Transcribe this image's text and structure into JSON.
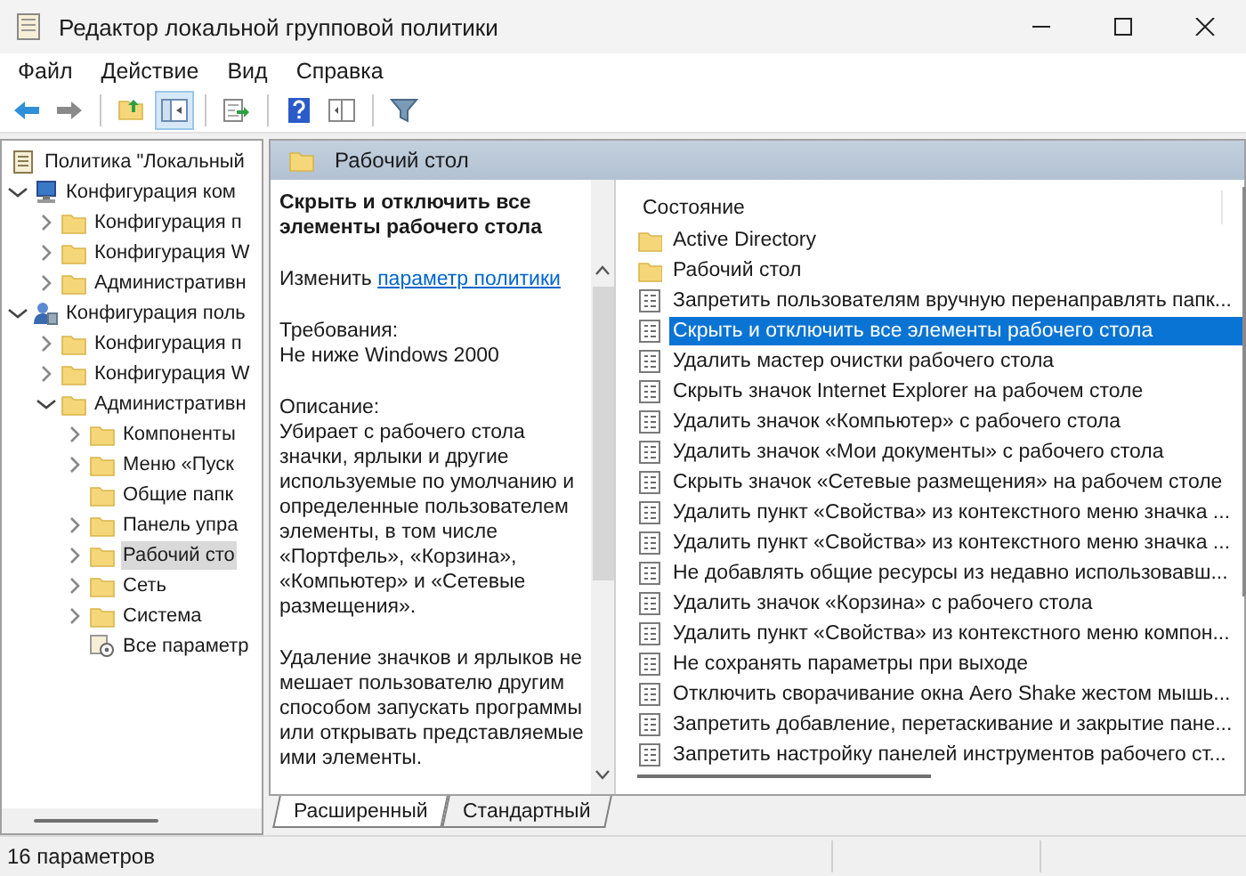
{
  "window": {
    "title": "Редактор локальной групповой политики"
  },
  "menu": [
    "Файл",
    "Действие",
    "Вид",
    "Справка"
  ],
  "toolbar": [
    {
      "kind": "back",
      "pressed": false
    },
    {
      "kind": "forward",
      "pressed": false
    },
    {
      "kind": "sep"
    },
    {
      "kind": "folder-up",
      "pressed": false
    },
    {
      "kind": "tree-toggle",
      "pressed": true
    },
    {
      "kind": "sep"
    },
    {
      "kind": "export",
      "pressed": false
    },
    {
      "kind": "sep"
    },
    {
      "kind": "help",
      "pressed": false
    },
    {
      "kind": "view",
      "pressed": false
    },
    {
      "kind": "sep"
    },
    {
      "kind": "filter",
      "pressed": false
    }
  ],
  "tree": [
    {
      "label": "Политика \"Локальный",
      "kind": "policy-doc",
      "selected": false,
      "children": [
        {
          "label": "Конфигурация ком",
          "kind": "computer",
          "expanded": true,
          "selected": false,
          "children": [
            {
              "label": "Конфигурация п",
              "kind": "folder",
              "expanded": false,
              "selected": false
            },
            {
              "label": "Конфигурация W",
              "kind": "folder",
              "expanded": false,
              "selected": false
            },
            {
              "label": "Административн",
              "kind": "folder",
              "expanded": false,
              "selected": false
            }
          ]
        },
        {
          "label": "Конфигурация поль",
          "kind": "user",
          "expanded": true,
          "selected": false,
          "children": [
            {
              "label": "Конфигурация п",
              "kind": "folder",
              "expanded": false,
              "selected": false
            },
            {
              "label": "Конфигурация W",
              "kind": "folder",
              "expanded": false,
              "selected": false
            },
            {
              "label": "Административн",
              "kind": "folder",
              "expanded": true,
              "selected": false,
              "children": [
                {
                  "label": "Компоненты",
                  "kind": "folder",
                  "expanded": false,
                  "selected": false
                },
                {
                  "label": "Меню «Пуск",
                  "kind": "folder",
                  "expanded": false,
                  "selected": false
                },
                {
                  "label": "Общие папк",
                  "kind": "folder",
                  "selected": false
                },
                {
                  "label": "Панель упра",
                  "kind": "folder",
                  "expanded": false,
                  "selected": false
                },
                {
                  "label": "Рабочий сто",
                  "kind": "folder",
                  "expanded": false,
                  "selected": true
                },
                {
                  "label": "Сеть",
                  "kind": "folder",
                  "expanded": false,
                  "selected": false
                },
                {
                  "label": "Система",
                  "kind": "folder",
                  "expanded": false,
                  "selected": false
                },
                {
                  "label": "Все параметр",
                  "kind": "settings",
                  "selected": false
                }
              ]
            }
          ]
        }
      ]
    }
  ],
  "header": {
    "title": "Рабочий стол"
  },
  "description": {
    "title": "Скрыть и отключить все элементы рабочего стола",
    "edit_prefix": "Изменить",
    "edit_link": "параметр политики",
    "requirements_label": "Требования:",
    "requirements": "Не ниже Windows 2000",
    "description_label": "Описание:",
    "description": "Убирает с рабочего стола значки, ярлыки и другие используемые по умолчанию и определенные пользователем элементы, в том числе «Портфель», «Корзина», «Компьютер» и «Сетевые размещения».",
    "note": "Удаление значков и ярлыков не мешает пользователю другим способом запускать программы или открывать представляемые ими элементы."
  },
  "list": {
    "column": "Состояние",
    "items": [
      {
        "label": "Active Directory",
        "kind": "folder",
        "selected": false
      },
      {
        "label": "Рабочий стол",
        "kind": "folder",
        "selected": false
      },
      {
        "label": "Запретить пользователям вручную перенаправлять папк...",
        "kind": "policy",
        "selected": false
      },
      {
        "label": "Скрыть и отключить все элементы рабочего стола",
        "kind": "policy",
        "selected": true
      },
      {
        "label": "Удалить мастер очистки рабочего стола",
        "kind": "policy",
        "selected": false
      },
      {
        "label": "Скрыть значок Internet Explorer на рабочем столе",
        "kind": "policy",
        "selected": false
      },
      {
        "label": "Удалить значок «Компьютер» с рабочего стола",
        "kind": "policy",
        "selected": false
      },
      {
        "label": "Удалить значок «Мои документы» с рабочего стола",
        "kind": "policy",
        "selected": false
      },
      {
        "label": "Скрыть значок «Сетевые размещения» на рабочем столе",
        "kind": "policy",
        "selected": false
      },
      {
        "label": "Удалить пункт «Свойства» из контекстного меню значка ...",
        "kind": "policy",
        "selected": false
      },
      {
        "label": "Удалить пункт «Свойства» из контекстного меню значка ...",
        "kind": "policy",
        "selected": false
      },
      {
        "label": "Не добавлять общие ресурсы из недавно использовавш...",
        "kind": "policy",
        "selected": false
      },
      {
        "label": "Удалить значок «Корзина» с рабочего стола",
        "kind": "policy",
        "selected": false
      },
      {
        "label": "Удалить пункт «Свойства» из контекстного меню компон...",
        "kind": "policy",
        "selected": false
      },
      {
        "label": "Не сохранять параметры при выходе",
        "kind": "policy",
        "selected": false
      },
      {
        "label": "Отключить сворачивание окна Aero Shake жестом мышь...",
        "kind": "policy",
        "selected": false
      },
      {
        "label": "Запретить добавление, перетаскивание и закрытие пане...",
        "kind": "policy",
        "selected": false
      },
      {
        "label": "Запретить настройку панелей инструментов рабочего ст...",
        "kind": "policy",
        "selected": false
      }
    ]
  },
  "view_tabs": [
    {
      "label": "Расширенный",
      "selected": true
    },
    {
      "label": "Стандартный",
      "selected": false
    }
  ],
  "status_bar": {
    "text": "16 параметров"
  }
}
